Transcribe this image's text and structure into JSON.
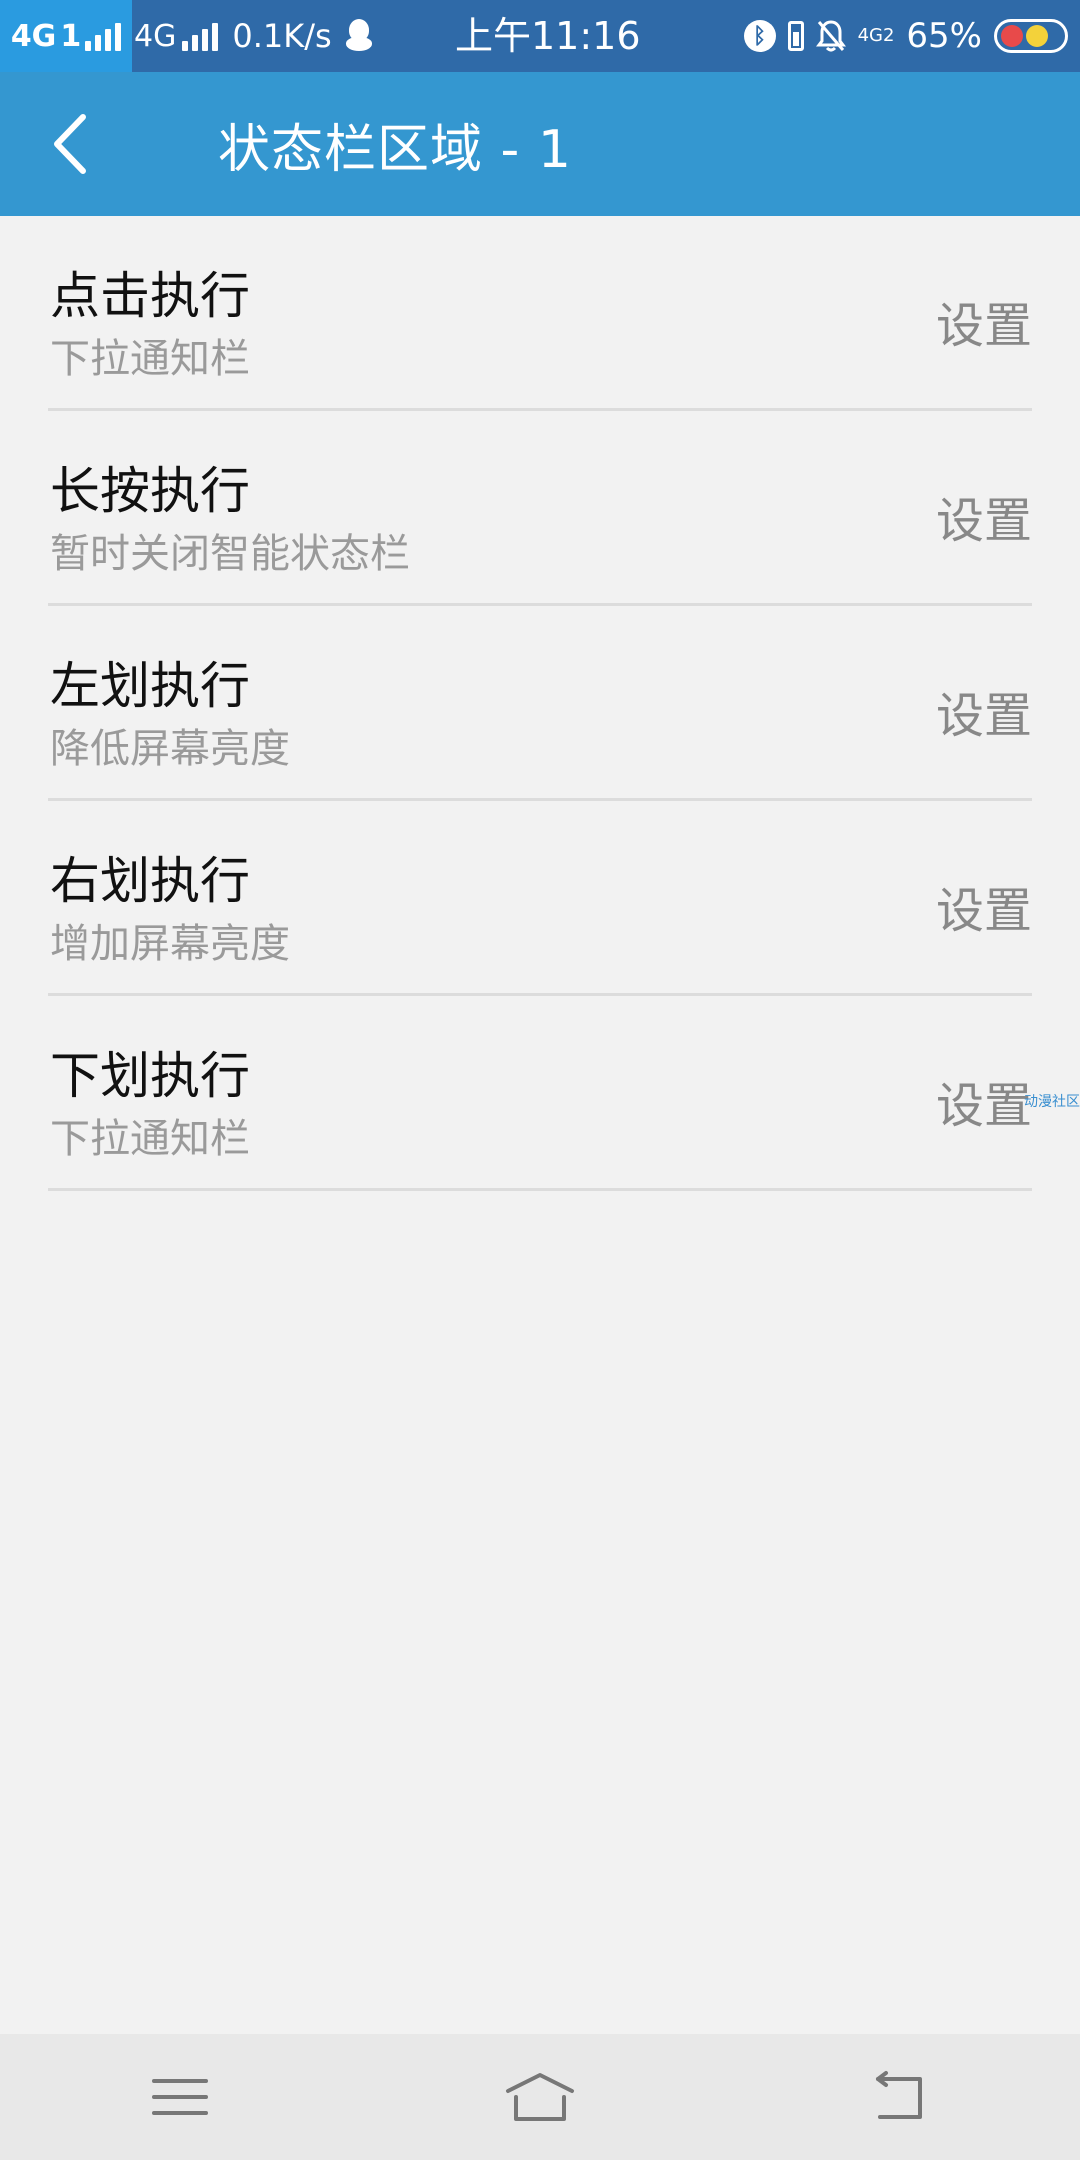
{
  "status_bar": {
    "sim1_label": "4G",
    "sim1_number": "1",
    "sim2_label": "4G",
    "net_speed": "0.1K/s",
    "time": "上午11:16",
    "net_4g2": "4G2",
    "battery_percent": "65%",
    "colors": {
      "background": "#2f6aa8",
      "sim1_background": "#2a9be0"
    }
  },
  "header": {
    "title": "状态栏区域 - 1",
    "background": "#3497d0"
  },
  "list": [
    {
      "title": "点击执行",
      "subtitle": "下拉通知栏",
      "action": "设置"
    },
    {
      "title": "长按执行",
      "subtitle": "暂时关闭智能状态栏",
      "action": "设置"
    },
    {
      "title": "左划执行",
      "subtitle": "降低屏幕亮度",
      "action": "设置"
    },
    {
      "title": "右划执行",
      "subtitle": "增加屏幕亮度",
      "action": "设置"
    },
    {
      "title": "下划执行",
      "subtitle": "下拉通知栏",
      "action": "设置"
    }
  ],
  "watermark": "动漫社区",
  "nav_bar": {
    "icons": [
      "menu-icon",
      "home-icon",
      "back-icon"
    ]
  }
}
